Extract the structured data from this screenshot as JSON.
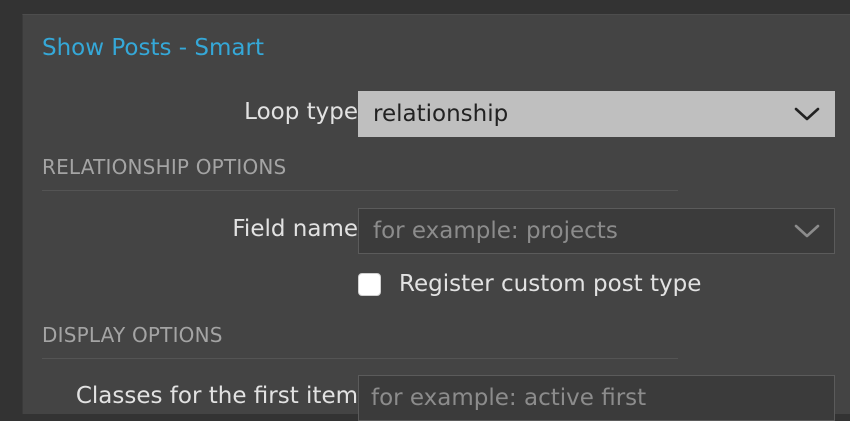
{
  "panel": {
    "title": "Show Posts - Smart"
  },
  "loop_type": {
    "label": "Loop type",
    "value": "relationship",
    "icon": "chevron-down-icon"
  },
  "relationship_options": {
    "heading": "RELATIONSHIP OPTIONS",
    "field_name": {
      "label": "Field name",
      "placeholder": "for example: projects",
      "icon": "chevron-down-icon"
    },
    "register_cpt": {
      "label": "Register custom post type",
      "checked": false
    }
  },
  "display_options": {
    "heading": "DISPLAY OPTIONS",
    "first_item_classes": {
      "label": "Classes for the first item",
      "placeholder": "for example: active first"
    }
  }
}
